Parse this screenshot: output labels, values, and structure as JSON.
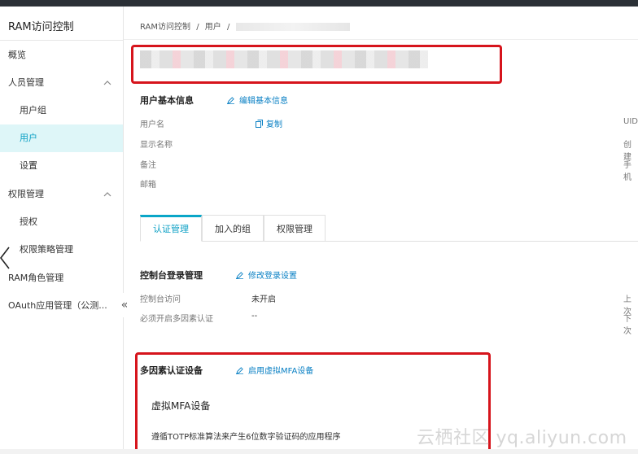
{
  "sidebar": {
    "title": "RAM访问控制",
    "items": [
      {
        "label": "概览"
      },
      {
        "label": "人员管理"
      },
      {
        "label": "用户组"
      },
      {
        "label": "用户"
      },
      {
        "label": "设置"
      },
      {
        "label": "权限管理"
      },
      {
        "label": "授权"
      },
      {
        "label": "权限策略管理"
      },
      {
        "label": "RAM角色管理"
      },
      {
        "label": "OAuth应用管理（公测..."
      }
    ],
    "collapse_glyph": "«"
  },
  "breadcrumb": {
    "root": "RAM访问控制",
    "sep1": "/",
    "users": "用户",
    "sep2": "/"
  },
  "basic_info": {
    "title": "用户基本信息",
    "edit_label": "编辑基本信息",
    "fields": {
      "username": "用户名",
      "display_name": "显示名称",
      "note": "备注",
      "email": "邮箱"
    },
    "copy_label": "复制",
    "right_cut": [
      "UID",
      "创建",
      "手机"
    ]
  },
  "tabs": [
    {
      "label": "认证管理"
    },
    {
      "label": "加入的组"
    },
    {
      "label": "权限管理"
    }
  ],
  "console_login": {
    "title": "控制台登录管理",
    "edit_label": "修改登录设置",
    "rows": [
      {
        "label": "控制台访问",
        "value": "未开启",
        "cut": "上次"
      },
      {
        "label": "必须开启多因素认证",
        "value": "--",
        "cut": "下次"
      }
    ]
  },
  "mfa": {
    "title": "多因素认证设备",
    "enable_label": "启用虚拟MFA设备",
    "card_title": "虚拟MFA设备",
    "description": "遵循TOTP标准算法来产生6位数字验证码的应用程序"
  },
  "watermark": "云栖社区 yq.aliyun.com",
  "colors": {
    "accent": "#0aa6c8",
    "link": "#0a80c4",
    "highlight_box": "#d6141c",
    "active_bg": "#def6f8"
  }
}
